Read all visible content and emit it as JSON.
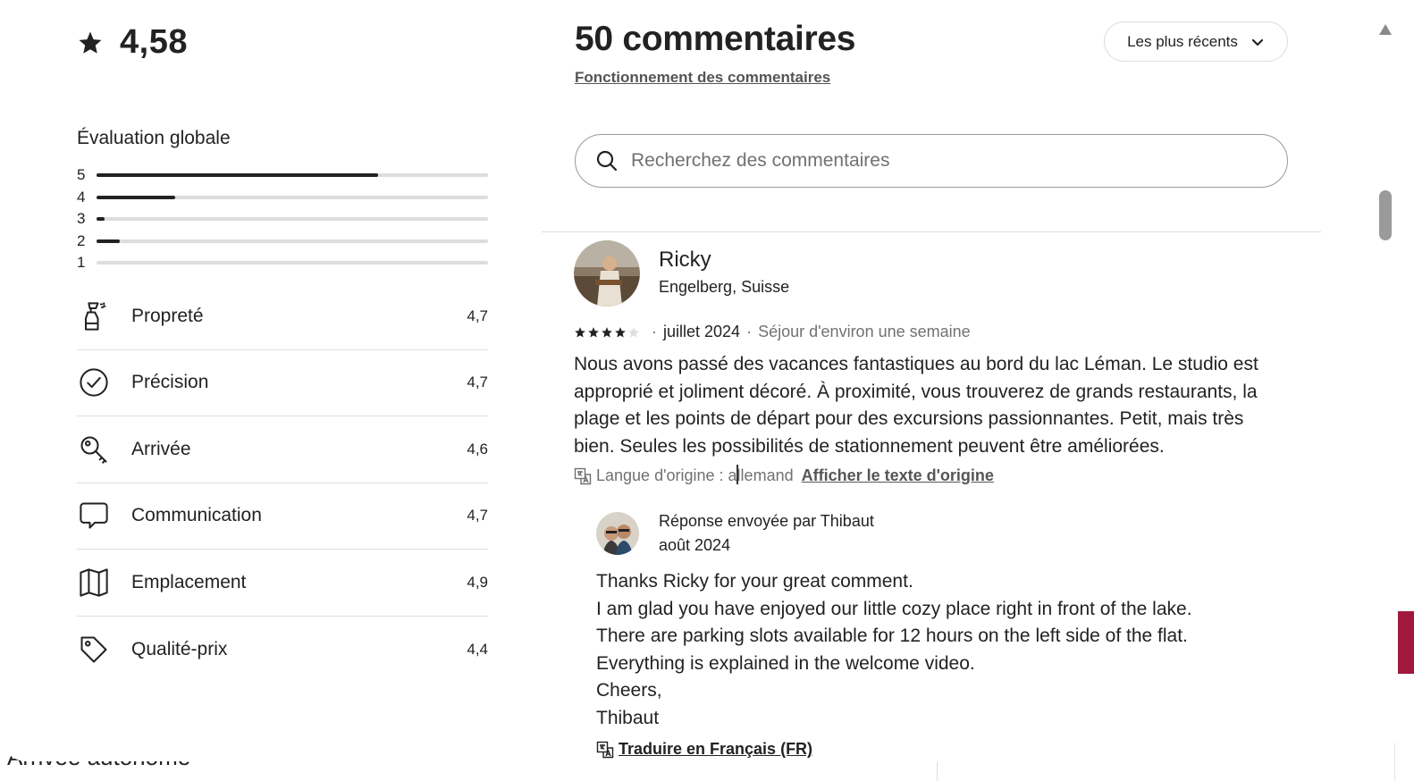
{
  "backdrop": {
    "text": "Arrivée autonome"
  },
  "overall": {
    "rating": "4,58"
  },
  "evaluation": {
    "title": "Évaluation globale",
    "distribution": [
      {
        "label": "5",
        "fraction": 0.72
      },
      {
        "label": "4",
        "fraction": 0.2
      },
      {
        "label": "3",
        "fraction": 0.02
      },
      {
        "label": "2",
        "fraction": 0.06
      },
      {
        "label": "1",
        "fraction": 0.0
      }
    ]
  },
  "categories": [
    {
      "label": "Propreté",
      "score": "4,7",
      "icon": "spray-bottle-icon"
    },
    {
      "label": "Précision",
      "score": "4,7",
      "icon": "check-circle-icon"
    },
    {
      "label": "Arrivée",
      "score": "4,6",
      "icon": "key-icon"
    },
    {
      "label": "Communication",
      "score": "4,7",
      "icon": "chat-bubble-icon"
    },
    {
      "label": "Emplacement",
      "score": "4,9",
      "icon": "map-icon"
    },
    {
      "label": "Qualité-prix",
      "score": "4,4",
      "icon": "tag-icon"
    }
  ],
  "reviews_header": {
    "title": "50 commentaires",
    "how_link": "Fonctionnement des commentaires",
    "sort_label": "Les plus récents"
  },
  "search": {
    "placeholder": "Recherchez des commentaires",
    "value": ""
  },
  "review": {
    "name": "Ricky",
    "location": "Engelberg, Suisse",
    "stars": 4,
    "date": "juillet 2024",
    "stay": "Séjour d'environ une semaine",
    "text": "Nous avons passé des vacances fantastiques au bord du lac Léman. Le studio est approprié et joliment décoré. À proximité, vous trouverez de grands restaurants, la plage et les points de départ pour des excursions passionnantes. Petit, mais très bien. Seules les possibilités de stationnement peuvent être améliorées.",
    "orig_lang": "Langue d'origine : allemand",
    "show_original": "Afficher le texte d'origine"
  },
  "host_response": {
    "title": "Réponse envoyée par Thibaut",
    "date": "août 2024",
    "lines": [
      "Thanks Ricky for your great comment.",
      "I am glad you have enjoyed our little cozy place right in front of the lake.",
      "There are parking slots available for 12 hours on the left side of the flat.",
      "Everything is explained in the welcome video.",
      "Cheers,",
      "Thibaut"
    ],
    "translate_link": "Traduire en Français (FR)"
  }
}
